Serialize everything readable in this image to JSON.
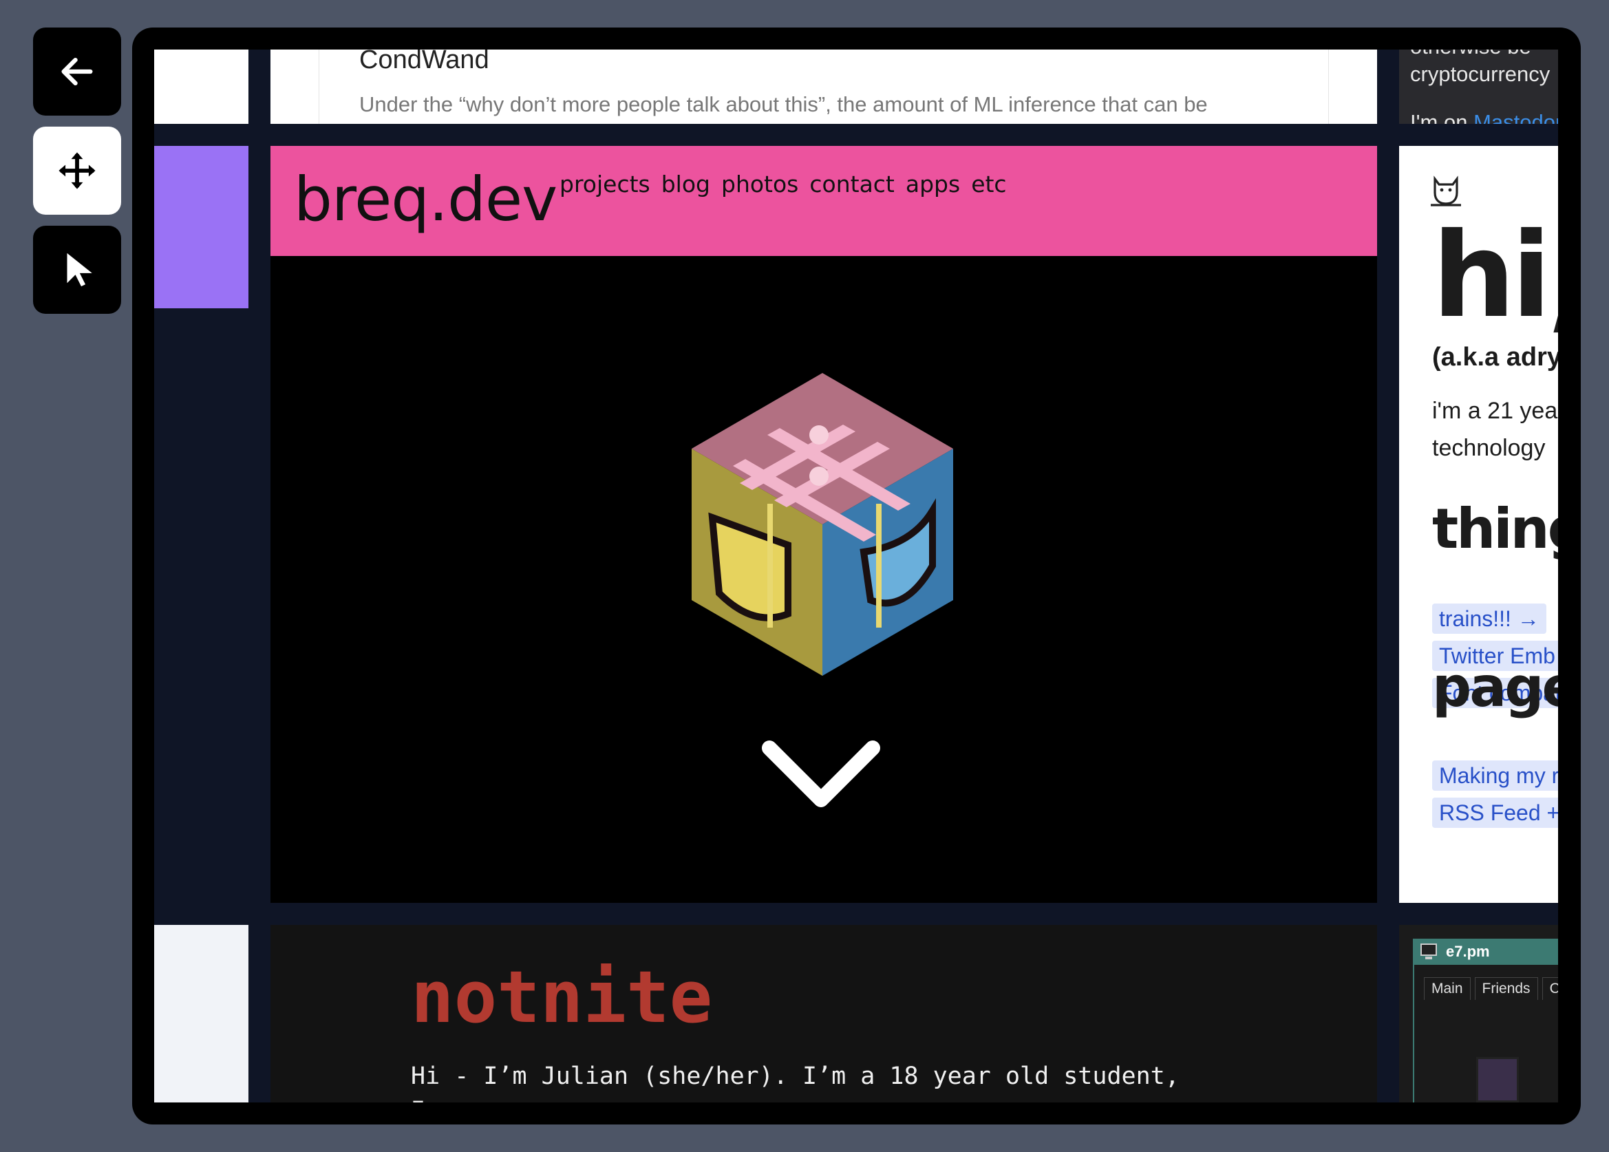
{
  "toolbar": {
    "tools": [
      {
        "name": "back",
        "icon": "arrow-left-icon",
        "active": false
      },
      {
        "name": "move",
        "icon": "move-arrows-icon",
        "active": true
      },
      {
        "name": "select",
        "icon": "pointer-cursor-icon",
        "active": false
      }
    ]
  },
  "tiles": {
    "condwand": {
      "title": "CondWand",
      "snippet": "Under the “why don’t more people talk about this”, the amount of ML inference that can be"
    },
    "crypto": {
      "line0": "otherwise  be",
      "line1": "cryptocurrency",
      "line2_prefix": "I'm on ",
      "line2_link": "Mastodon"
    },
    "breq": {
      "logo": "breq.dev",
      "nav": [
        "projects",
        "blog",
        "photos",
        "contact",
        "apps",
        "etc"
      ],
      "colors": {
        "header": "#ec539e",
        "background": "#000000"
      }
    },
    "hi": {
      "heading": "hi,",
      "aka": "(a.k.a adry",
      "para_line1": "i'm a 21 yea",
      "para_line2": "technology",
      "things_heading": "thing",
      "things": [
        "trains!!! →",
        "Twitter Emb",
        "Font compar"
      ],
      "pages_heading": "page",
      "pages": [
        "Making my r",
        "RSS Feed +"
      ]
    },
    "notnite": {
      "heading": "notnite",
      "line1": "Hi - I’m Julian (she/her). I’m a 18 year old student,",
      "line2": "                                            I",
      "colors": {
        "heading": "#b23a30"
      }
    },
    "window": {
      "title": "e7.pm",
      "tabs": [
        "Main",
        "Friends",
        "C"
      ]
    }
  }
}
